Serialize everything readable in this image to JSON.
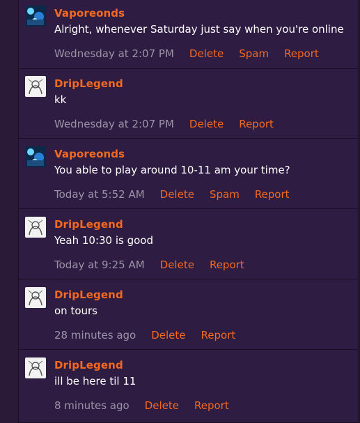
{
  "messages": [
    {
      "author": "Vaporeonds",
      "avatar": "vaporeon-avatar",
      "text": "Alright, whenever Saturday just say when you're online",
      "time": "Wednesday at 2:07 PM",
      "actions": [
        "Delete",
        "Spam",
        "Report"
      ]
    },
    {
      "author": "DripLegend",
      "avatar": "sketch-avatar",
      "text": "kk",
      "time": "Wednesday at 2:07 PM",
      "actions": [
        "Delete",
        "Report"
      ]
    },
    {
      "author": "Vaporeonds",
      "avatar": "vaporeon-avatar",
      "text": "You able to play around 10-11 am your time?",
      "time": "Today at 5:52 AM",
      "actions": [
        "Delete",
        "Spam",
        "Report"
      ]
    },
    {
      "author": "DripLegend",
      "avatar": "sketch-avatar",
      "text": "Yeah 10:30 is good",
      "time": "Today at 9:25 AM",
      "actions": [
        "Delete",
        "Report"
      ]
    },
    {
      "author": "DripLegend",
      "avatar": "sketch-avatar",
      "text": "on tours",
      "time": "28 minutes ago",
      "actions": [
        "Delete",
        "Report"
      ]
    },
    {
      "author": "DripLegend",
      "avatar": "sketch-avatar",
      "text": "ill be here til 11",
      "time": "8 minutes ago",
      "actions": [
        "Delete",
        "Report"
      ]
    }
  ],
  "colors": {
    "background": "#2e1c42",
    "accent": "#f26a21",
    "text": "#ffffff",
    "muted": "#9d93a8",
    "divider": "#1a0f24"
  }
}
